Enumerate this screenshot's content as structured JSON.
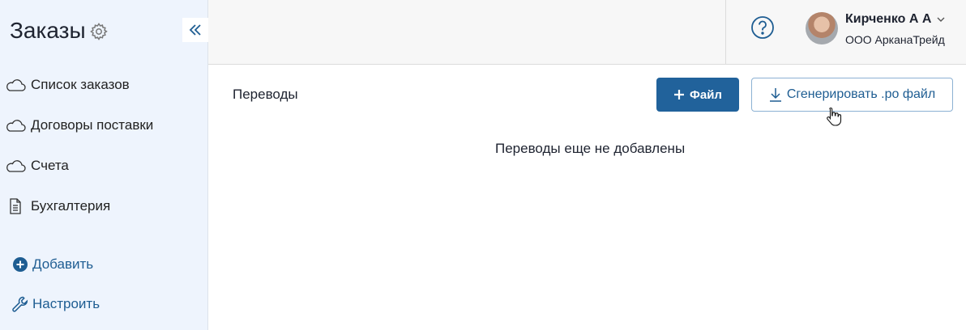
{
  "sidebar": {
    "title": "Заказы",
    "items": [
      {
        "label": "Список заказов",
        "icon": "cloud-icon"
      },
      {
        "label": "Договоры поставки",
        "icon": "cloud-icon"
      },
      {
        "label": "Счета",
        "icon": "cloud-icon"
      },
      {
        "label": "Бухгалтерия",
        "icon": "document-icon"
      }
    ],
    "actions": {
      "add_label": "Добавить",
      "configure_label": "Настроить"
    }
  },
  "user": {
    "name": "Кирченко А А",
    "company": "ООО АрканаТрейд"
  },
  "main": {
    "section_title": "Переводы",
    "file_button_label": "Файл",
    "generate_button_label": "Сгенерировать .po файл",
    "empty_message": "Переводы еще не добавлены"
  },
  "colors": {
    "primary": "#21629b",
    "sidebar_bg": "#eef4fd",
    "link": "#1e5d92"
  }
}
